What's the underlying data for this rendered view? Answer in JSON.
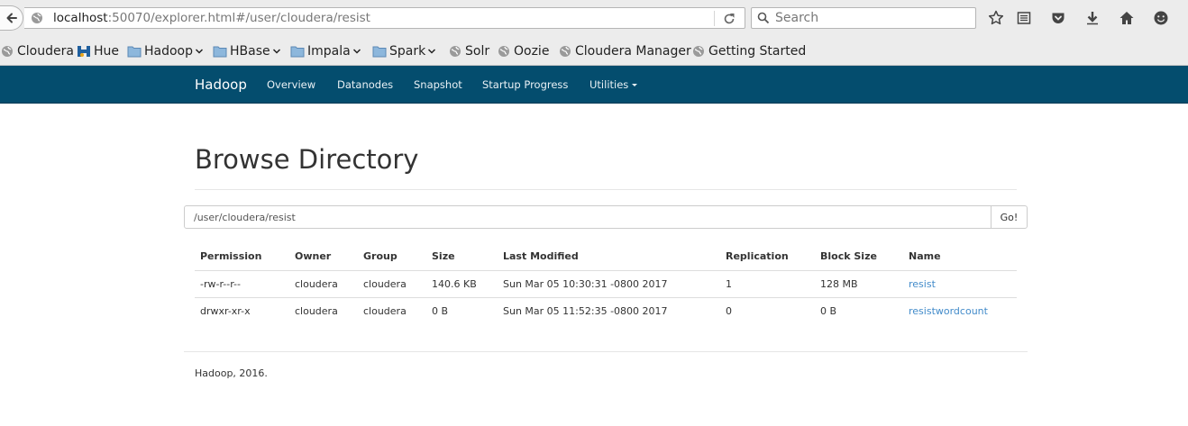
{
  "browser": {
    "url_host": "localhost",
    "url_rest": ":50070/explorer.html#/user/cloudera/resist",
    "search_placeholder": "Search"
  },
  "bookmarks": [
    {
      "label": "Cloudera",
      "icon": "globe-icon"
    },
    {
      "label": "Hue",
      "icon": "hue-icon"
    },
    {
      "label": "Hadoop",
      "icon": "folder-icon",
      "menu": true
    },
    {
      "label": "HBase",
      "icon": "folder-icon",
      "menu": true
    },
    {
      "label": "Impala",
      "icon": "folder-icon",
      "menu": true
    },
    {
      "label": "Spark",
      "icon": "folder-icon",
      "menu": true
    },
    {
      "label": "Solr",
      "icon": "globe-icon"
    },
    {
      "label": "Oozie",
      "icon": "globe-icon"
    },
    {
      "label": "Cloudera Manager",
      "icon": "globe-icon"
    },
    {
      "label": "Getting Started",
      "icon": "globe-icon"
    }
  ],
  "navbar": {
    "brand": "Hadoop",
    "items": [
      "Overview",
      "Datanodes",
      "Snapshot",
      "Startup Progress",
      "Utilities"
    ]
  },
  "page": {
    "title": "Browse Directory",
    "path_value": "/user/cloudera/resist",
    "go_label": "Go!"
  },
  "table": {
    "headers": [
      "Permission",
      "Owner",
      "Group",
      "Size",
      "Last Modified",
      "Replication",
      "Block Size",
      "Name"
    ],
    "rows": [
      [
        "-rw-r--r--",
        "cloudera",
        "cloudera",
        "140.6 KB",
        "Sun Mar 05 10:30:31 -0800 2017",
        "1",
        "128 MB",
        "resist"
      ],
      [
        "drwxr-xr-x",
        "cloudera",
        "cloudera",
        "0 B",
        "Sun Mar 05 11:52:35 -0800 2017",
        "0",
        "0 B",
        "resistwordcount"
      ]
    ]
  },
  "footer": "Hadoop, 2016.",
  "colors": {
    "navbar": "#044d6e",
    "link": "#428bca"
  }
}
